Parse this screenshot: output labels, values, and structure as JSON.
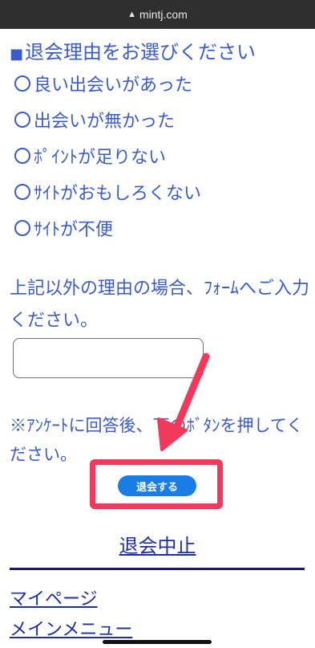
{
  "browser": {
    "url": "mintj.com",
    "lock_glyph": "▲"
  },
  "heading": {
    "marker": "■",
    "text": "退会理由をお選びください"
  },
  "reasons": [
    {
      "label": "良い出会いがあった"
    },
    {
      "label": "出会いが無かった"
    },
    {
      "label": "ﾎﾟｲﾝﾄが足りない"
    },
    {
      "label": "ｻｲﾄがおもしろくない"
    },
    {
      "label": "ｻｲﾄが不便"
    }
  ],
  "other_reason": {
    "instruction": "上記以外の理由の場合、ﾌｫｰﾑへご入力ください。",
    "value": ""
  },
  "survey_note": "※ｱﾝｹｰﾄに回答後、下のﾎﾞﾀﾝを押してください。",
  "submit_label": "退会する",
  "cancel_label": "退会中止",
  "nav": {
    "mypage": "マイページ",
    "main_menu": "メインメニュー"
  },
  "colors": {
    "text": "#3b5bc8",
    "button": "#1a7de6",
    "annotation": "#f2385b",
    "link": "#1f2ea0"
  }
}
